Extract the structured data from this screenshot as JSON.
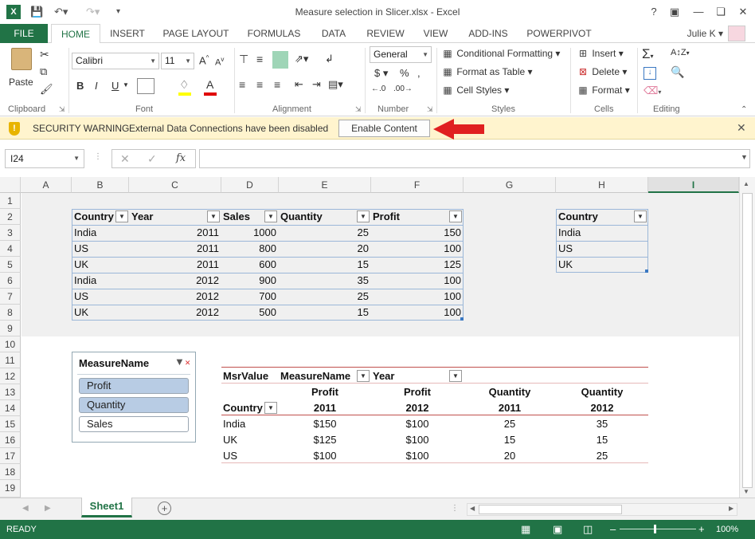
{
  "window": {
    "title": "Measure selection in Slicer.xlsx - Excel",
    "user": "Julie K",
    "help_label": "?"
  },
  "tabs": [
    "FILE",
    "HOME",
    "INSERT",
    "PAGE LAYOUT",
    "FORMULAS",
    "DATA",
    "REVIEW",
    "VIEW",
    "ADD-INS",
    "POWERPIVOT"
  ],
  "ribbon": {
    "paste": "Paste",
    "font_name": "Calibri",
    "font_size": "11",
    "bold": "B",
    "italic": "I",
    "underline": "U",
    "number_format": "General",
    "conditional_formatting": "Conditional Formatting",
    "format_as_table": "Format as Table",
    "cell_styles": "Cell Styles",
    "insert": "Insert",
    "delete": "Delete",
    "format": "Format",
    "groups": {
      "clipboard": "Clipboard",
      "font": "Font",
      "alignment": "Alignment",
      "number": "Number",
      "styles": "Styles",
      "cells": "Cells",
      "editing": "Editing"
    }
  },
  "security_bar": {
    "warning": "SECURITY WARNING",
    "message": "External Data Connections have been disabled",
    "button": "Enable Content"
  },
  "formula_bar": {
    "name_box": "I24",
    "fx": "fx",
    "formula": ""
  },
  "columns": [
    "A",
    "B",
    "C",
    "D",
    "E",
    "F",
    "G",
    "H",
    "I"
  ],
  "rows": [
    "1",
    "2",
    "3",
    "4",
    "5",
    "6",
    "7",
    "8",
    "9",
    "10",
    "11",
    "12",
    "13",
    "14",
    "15",
    "16",
    "17",
    "18",
    "19"
  ],
  "main_table": {
    "headers": [
      "Country",
      "Year",
      "Sales",
      "Quantity",
      "Profit"
    ],
    "rows": [
      [
        "India",
        "2011",
        "1000",
        "25",
        "150"
      ],
      [
        "US",
        "2011",
        "800",
        "20",
        "100"
      ],
      [
        "UK",
        "2011",
        "600",
        "15",
        "125"
      ],
      [
        "India",
        "2012",
        "900",
        "35",
        "100"
      ],
      [
        "US",
        "2012",
        "700",
        "25",
        "100"
      ],
      [
        "UK",
        "2012",
        "500",
        "15",
        "100"
      ]
    ]
  },
  "country_table": {
    "header": "Country",
    "rows": [
      "India",
      "US",
      "UK"
    ]
  },
  "slicer": {
    "title": "MeasureName",
    "items": [
      {
        "label": "Profit",
        "selected": true
      },
      {
        "label": "Quantity",
        "selected": true
      },
      {
        "label": "Sales",
        "selected": false
      }
    ]
  },
  "pivot": {
    "corner": "MsrValue",
    "col_field_1": "MeasureName",
    "col_field_2": "Year",
    "row_field": "Country",
    "measure_headers": [
      "Profit",
      "Profit",
      "Quantity",
      "Quantity"
    ],
    "year_headers": [
      "2011",
      "2012",
      "2011",
      "2012"
    ],
    "rows": [
      [
        "India",
        "$150",
        "$100",
        "25",
        "35"
      ],
      [
        "UK",
        "$125",
        "$100",
        "15",
        "15"
      ],
      [
        "US",
        "$100",
        "$100",
        "20",
        "25"
      ]
    ]
  },
  "sheet_tab": "Sheet1",
  "status": {
    "ready": "READY",
    "zoom": "100%"
  },
  "colors": {
    "accent": "#217346",
    "security_bg": "#fff4ce",
    "slicer_selected": "#b8cce4",
    "arrow": "#e02020"
  }
}
